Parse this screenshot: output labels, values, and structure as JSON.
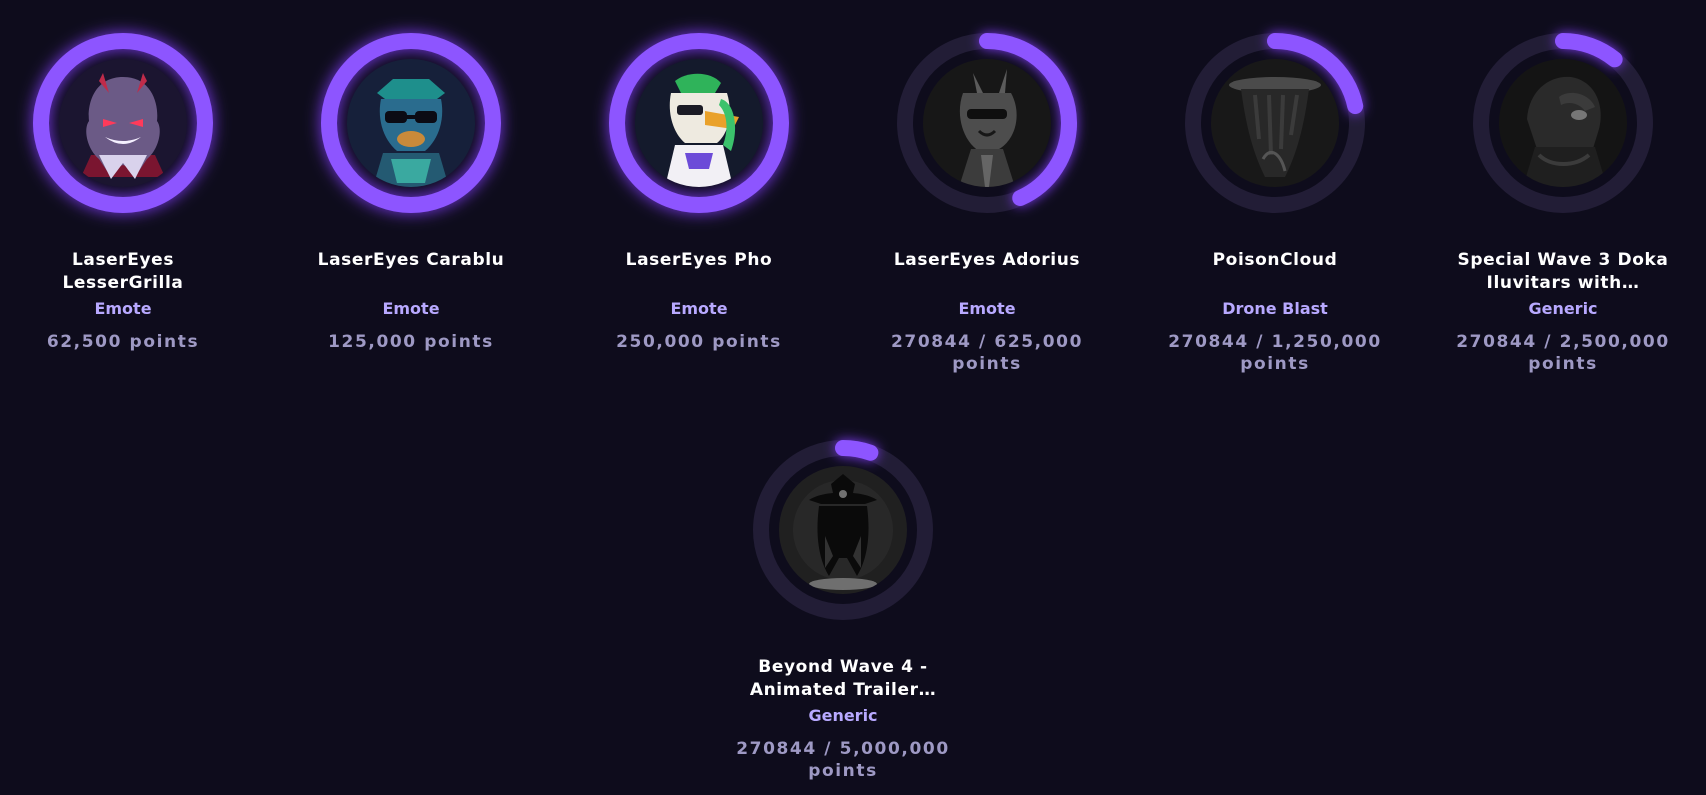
{
  "colors": {
    "background": "#0e0c1c",
    "ring_track": "#221d36",
    "ring_fill": "#8d55ff",
    "ring_glow": "#7c3aed",
    "title": "#ffffff",
    "type": "#b8a9ff",
    "points": "#9e99c4"
  },
  "rewards": [
    {
      "title": "LaserEyes LesserGrilla",
      "type": "Emote",
      "points": "62,500 points",
      "progress": 1.0,
      "unlocked": true,
      "image": "laser-eyes-gorilla-emote-image"
    },
    {
      "title": "LaserEyes Carablu",
      "type": "Emote",
      "points": "125,000 points",
      "progress": 1.0,
      "unlocked": true,
      "image": "carablu-emote-image"
    },
    {
      "title": "LaserEyes Pho",
      "type": "Emote",
      "points": "250,000 points",
      "progress": 1.0,
      "unlocked": true,
      "image": "pho-duck-emote-image"
    },
    {
      "title": "LaserEyes Adorius",
      "type": "Emote",
      "points": "270844 / 625,000 points",
      "progress": 0.4334,
      "unlocked": false,
      "image": "adorius-emote-image"
    },
    {
      "title": "PoisonCloud",
      "type": "Drone Blast",
      "points": "270844 / 1,250,000 points",
      "progress": 0.2167,
      "unlocked": false,
      "image": "poison-cloud-image"
    },
    {
      "title": "Special Wave 3 Doka Iluvitars with…",
      "type": "Generic",
      "points": "270844 / 2,500,000 points",
      "progress": 0.1083,
      "unlocked": false,
      "image": "doka-iluvitar-image"
    },
    {
      "title": "Beyond Wave 4 - Animated Trailer…",
      "type": "Generic",
      "points": "270844 / 5,000,000 points",
      "progress": 0.0542,
      "unlocked": false,
      "image": "animated-trailer-figure-image"
    }
  ]
}
